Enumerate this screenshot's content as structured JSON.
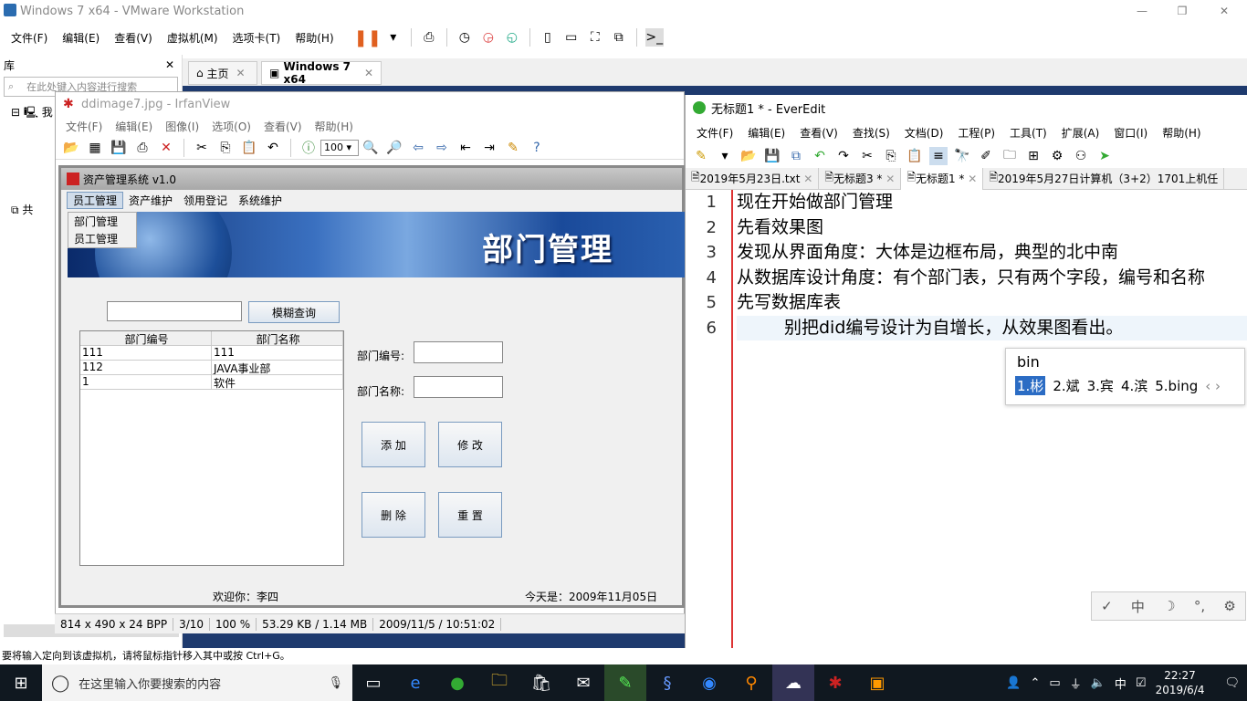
{
  "vmware": {
    "title": "Windows 7 x64 - VMware Workstation",
    "menu": [
      "文件(F)",
      "编辑(E)",
      "查看(V)",
      "虚拟机(M)",
      "选项卡(T)",
      "帮助(H)"
    ],
    "library": {
      "label": "库",
      "search_placeholder": "在此处键入内容进行搜索",
      "tree": [
        "我",
        "共"
      ]
    },
    "tabs": [
      {
        "label": "主页"
      },
      {
        "label": "Windows 7 x64"
      }
    ],
    "status": "要将输入定向到该虚拟机，请将鼠标指针移入其中或按 Ctrl+G。"
  },
  "irfanview": {
    "title": "ddimage7.jpg - IrfanView",
    "menu": [
      "文件(F)",
      "编辑(E)",
      "图像(I)",
      "选项(O)",
      "查看(V)",
      "帮助(H)"
    ],
    "zoom": "100",
    "status": [
      "814 x 490 x 24 BPP",
      "3/10",
      "100 %",
      "53.29 KB / 1.14 MB",
      "2009/11/5 / 10:51:02"
    ]
  },
  "app": {
    "title": "资产管理系统 v1.0",
    "menu": [
      "员工管理",
      "资产维护",
      "领用登记",
      "系统维护"
    ],
    "dropdown": [
      "部门管理",
      "员工管理"
    ],
    "banner": "部门管理",
    "search_btn": "模糊查询",
    "table": {
      "headers": [
        "部门编号",
        "部门名称"
      ],
      "rows": [
        [
          "111",
          "111"
        ],
        [
          "112",
          "JAVA事业部"
        ],
        [
          "1",
          "软件"
        ]
      ]
    },
    "labels": {
      "id": "部门编号:",
      "name": "部门名称:"
    },
    "buttons": {
      "add": "添  加",
      "edit": "修  改",
      "del": "删  除",
      "reset": "重  置"
    },
    "welcome": "欢迎你：李四",
    "today": "今天是：2009年11月05日"
  },
  "everedit": {
    "title": "无标题1 * - EverEdit",
    "menu": [
      "文件(F)",
      "编辑(E)",
      "查看(V)",
      "查找(S)",
      "文档(D)",
      "工程(P)",
      "工具(T)",
      "扩展(A)",
      "窗口(I)",
      "帮助(H)"
    ],
    "tabs": [
      "2019年5月23日.txt",
      "无标题3 *",
      "无标题1 *",
      "2019年5月27日计算机（3+2）1701上机任"
    ],
    "lines": [
      "现在开始做部门管理",
      "先看效果图",
      "发现从界面角度：大体是边框布局，典型的北中南",
      "从数据库设计角度：有个部门表，只有两个字段，编号和名称",
      "先写数据库表",
      "别把did编号设计为自增长，从效果图看出。"
    ],
    "line_numbers": [
      "1",
      "2",
      "3",
      "4",
      "5",
      "6"
    ]
  },
  "ime": {
    "input": "bin",
    "candidates": [
      "1.彬",
      "2.斌",
      "3.宾",
      "4.滨",
      "5.bing"
    ],
    "bar": [
      "✓",
      "中",
      "☽",
      "°,",
      "⚙"
    ]
  },
  "taskbar": {
    "search_placeholder": "在这里输入你要搜索的内容",
    "time": "22:27",
    "date": "2019/6/4",
    "lang": "中"
  }
}
